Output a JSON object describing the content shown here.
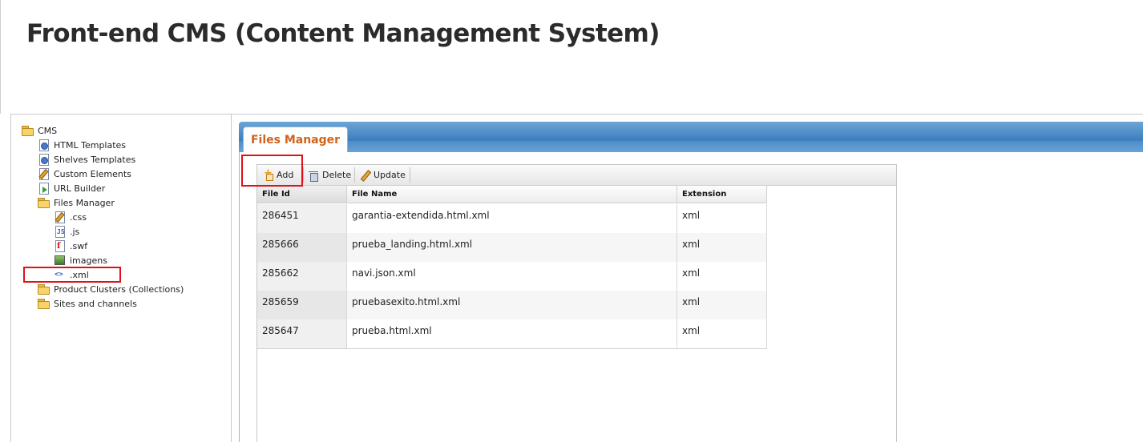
{
  "page": {
    "title": "Front-end CMS (Content Management System)"
  },
  "tree": {
    "root": {
      "label": "CMS",
      "icon": "folder-open-icon"
    },
    "items": [
      {
        "label": "HTML Templates",
        "icon": "gear-document-icon"
      },
      {
        "label": "Shelves Templates",
        "icon": "gear-document-icon"
      },
      {
        "label": "Custom Elements",
        "icon": "edit-document-icon"
      },
      {
        "label": "URL Builder",
        "icon": "arrow-document-icon"
      },
      {
        "label": "Files Manager",
        "icon": "folder-open-icon"
      }
    ],
    "files_children": [
      {
        "label": ".css",
        "icon": "css-file-icon"
      },
      {
        "label": ".js",
        "icon": "js-file-icon"
      },
      {
        "label": ".swf",
        "icon": "flash-file-icon"
      },
      {
        "label": "imagens",
        "icon": "image-file-icon"
      },
      {
        "label": ".xml",
        "icon": "xml-file-icon",
        "highlighted": true
      }
    ],
    "after_items": [
      {
        "label": "Product Clusters (Collections)",
        "icon": "folder-icon"
      },
      {
        "label": "Sites and channels",
        "icon": "folder-icon"
      }
    ]
  },
  "panel": {
    "tab_label": "Files Manager",
    "toolbar": {
      "add_label": "Add",
      "delete_label": "Delete",
      "update_label": "Update"
    },
    "grid": {
      "columns": [
        "File Id",
        "File Name",
        "Extension"
      ],
      "rows": [
        [
          "286451",
          "garantia-extendida.html.xml",
          "xml"
        ],
        [
          "285666",
          "prueba_landing.html.xml",
          "xml"
        ],
        [
          "285662",
          "navi.json.xml",
          "xml"
        ],
        [
          "285659",
          "pruebasexito.html.xml",
          "xml"
        ],
        [
          "285647",
          "prueba.html.xml",
          "xml"
        ]
      ]
    }
  },
  "colors": {
    "tab_text": "#d0621b",
    "panel_header": "#3c7fbf",
    "highlight": "#e0111b"
  }
}
